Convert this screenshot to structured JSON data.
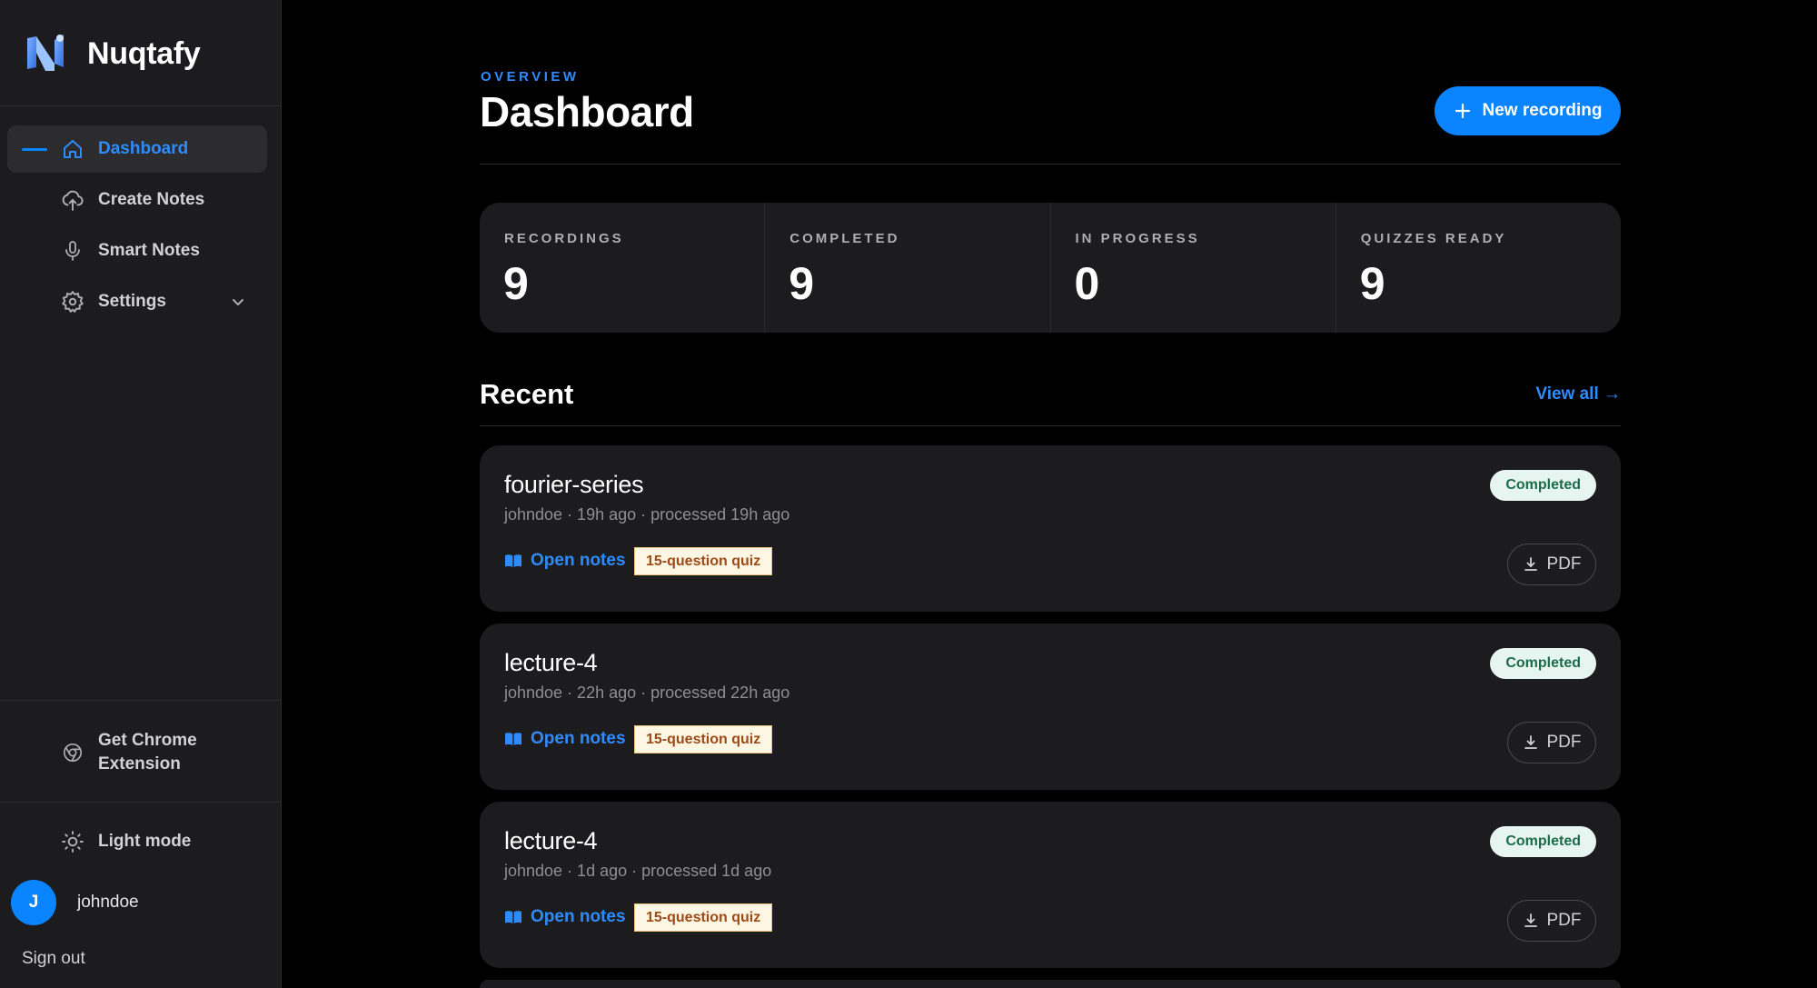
{
  "brand": {
    "name": "Nuqtafy"
  },
  "sidebar": {
    "nav": [
      {
        "label": "Dashboard",
        "icon": "home-icon",
        "active": true
      },
      {
        "label": "Create Notes",
        "icon": "cloud-upload-icon"
      },
      {
        "label": "Smart Notes",
        "icon": "microphone-icon"
      },
      {
        "label": "Settings",
        "icon": "gear-icon",
        "expandable": true
      }
    ],
    "chrome_extension": {
      "line1": "Get Chrome",
      "line2": "Extension",
      "icon": "chrome-icon"
    },
    "light_mode": {
      "label": "Light mode",
      "icon": "sun-icon"
    },
    "user": {
      "initial": "J",
      "name": "johndoe"
    },
    "sign_out": "Sign out"
  },
  "header": {
    "eyebrow": "OVERVIEW",
    "title": "Dashboard",
    "new_recording_label": "New recording"
  },
  "stats": [
    {
      "label": "RECORDINGS",
      "value": "9"
    },
    {
      "label": "COMPLETED",
      "value": "9"
    },
    {
      "label": "IN PROGRESS",
      "value": "0"
    },
    {
      "label": "QUIZZES READY",
      "value": "9"
    }
  ],
  "recent": {
    "title": "Recent",
    "view_all": "View all →",
    "items": [
      {
        "title": "fourier-series",
        "meta": "johndoe · 19h ago · processed 19h ago",
        "status": "Completed",
        "open_notes": "Open notes",
        "quiz": "15-question quiz",
        "pdf": "PDF"
      },
      {
        "title": "lecture-4",
        "meta": "johndoe · 22h ago · processed 22h ago",
        "status": "Completed",
        "open_notes": "Open notes",
        "quiz": "15-question quiz",
        "pdf": "PDF"
      },
      {
        "title": "lecture-4",
        "meta": "johndoe · 1d ago · processed 1d ago",
        "status": "Completed",
        "open_notes": "Open notes",
        "quiz": "15-question quiz",
        "pdf": "PDF"
      }
    ]
  },
  "colors": {
    "accent": "#0a84ff",
    "sidebar_bg": "#1c1c1e",
    "card_bg": "#1c1c1e",
    "badge_bg": "#e6f5ef",
    "badge_text": "#1d6b4f",
    "quiz_bg": "#fdf6e3",
    "quiz_text": "#9c4a17"
  }
}
